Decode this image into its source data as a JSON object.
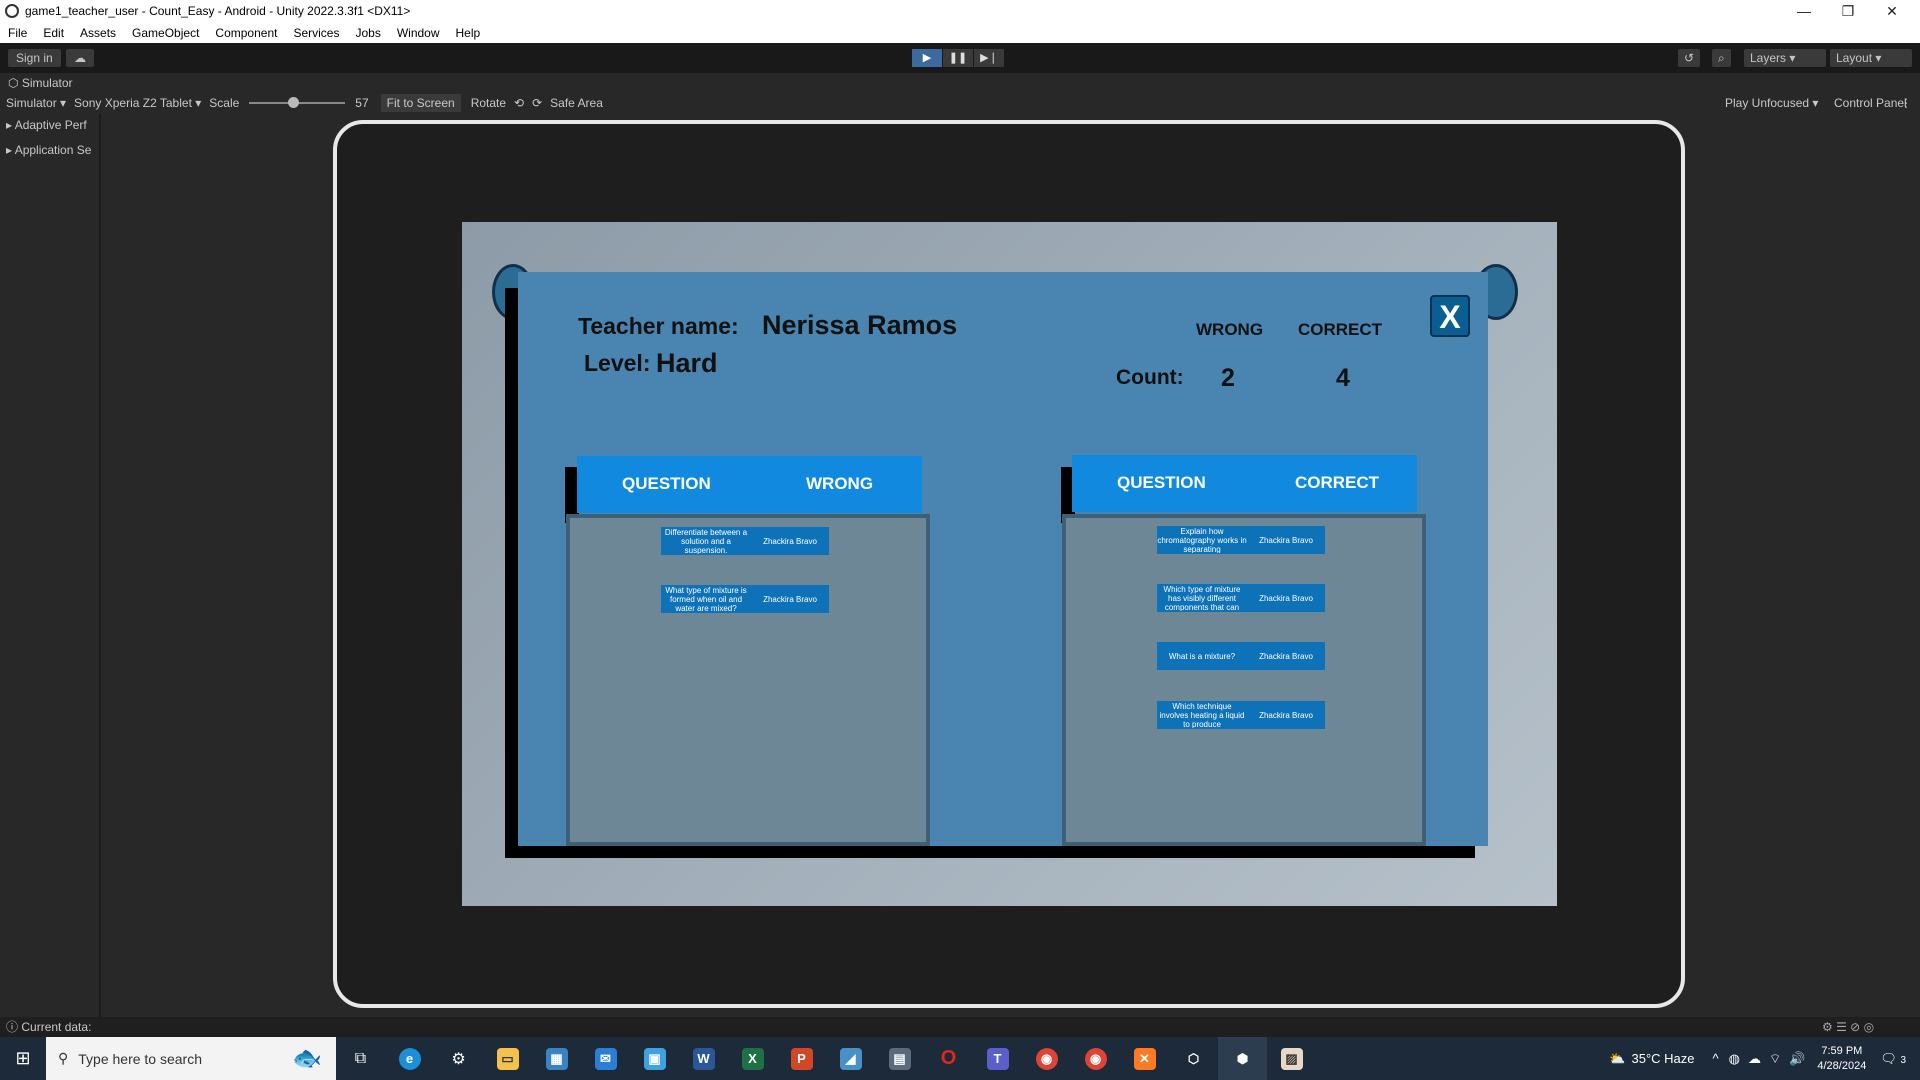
{
  "window": {
    "title": "game1_teacher_user - Count_Easy - Android - Unity 2022.3.3f1 <DX11>",
    "minimize": "—",
    "restore": "❐",
    "close": "✕"
  },
  "menu": [
    "File",
    "Edit",
    "Assets",
    "GameObject",
    "Component",
    "Services",
    "Jobs",
    "Window",
    "Help"
  ],
  "toolbar": {
    "sign_in": "Sign in",
    "layers": "Layers",
    "layout": "Layout"
  },
  "simulator": {
    "tab": "Simulator",
    "mode": "Simulator",
    "device": "Sony Xperia Z2 Tablet",
    "scale_label": "Scale",
    "scale_value": "57",
    "scale_fraction": 0.45,
    "fit": "Fit to Screen",
    "rotate": "Rotate",
    "safe_area": "Safe Area",
    "play_mode": "Play Unfocused",
    "control_panel": "Control Panel"
  },
  "left_panel": [
    "Adaptive Perf",
    "Application Se"
  ],
  "game": {
    "close_label": "X",
    "teacher_label": "Teacher name:",
    "teacher_name": "Nerissa Ramos",
    "level_label": "Level:",
    "level_value": "Hard",
    "wrong_label": "WRONG",
    "correct_label": "CORRECT",
    "count_label": "Count:",
    "wrong_count": "2",
    "correct_count": "4",
    "wrong_table": {
      "col1": "QUESTION",
      "col2": "WRONG",
      "rows": [
        {
          "question": "Differentiate between a solution and a suspension.",
          "name": "Zhackira Bravo"
        },
        {
          "question": "What type of mixture is formed when oil and water are mixed?",
          "name": "Zhackira Bravo"
        }
      ]
    },
    "correct_table": {
      "col1": "QUESTION",
      "col2": "CORRECT",
      "rows": [
        {
          "question": "Explain how chromatography works in separating",
          "name": "Zhackira Bravo"
        },
        {
          "question": "Which type of mixture has visibly different components that can",
          "name": "Zhackira Bravo"
        },
        {
          "question": "What is a mixture?",
          "name": "Zhackira Bravo"
        },
        {
          "question": "Which technique involves heating a liquid to produce",
          "name": "Zhackira Bravo"
        }
      ]
    }
  },
  "status": {
    "text": "Current data:"
  },
  "taskbar": {
    "search_placeholder": "Type here to search",
    "weather": "35°C  Haze",
    "time": "7:59 PM",
    "date": "4/28/2024",
    "notifications": "3"
  }
}
